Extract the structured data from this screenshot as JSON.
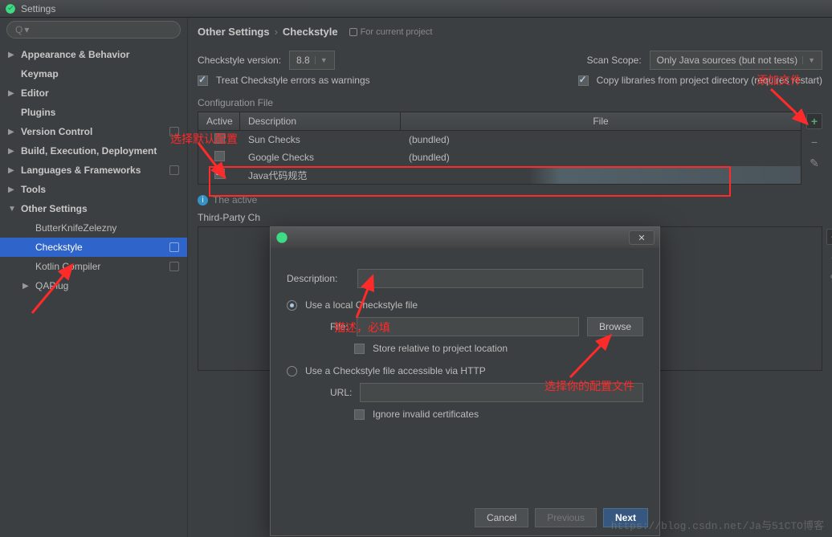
{
  "window": {
    "title": "Settings"
  },
  "search": {
    "placeholder": "Q"
  },
  "tree": {
    "appearance": "Appearance & Behavior",
    "keymap": "Keymap",
    "editor": "Editor",
    "plugins": "Plugins",
    "vcs": "Version Control",
    "build": "Build, Execution, Deployment",
    "lang": "Languages & Frameworks",
    "tools": "Tools",
    "other": "Other Settings",
    "butterknife": "ButterKnifeZelezny",
    "checkstyle": "Checkstyle",
    "kotlin": "Kotlin Compiler",
    "qaplug": "QAPlug"
  },
  "crumbs": {
    "other": "Other Settings",
    "checkstyle": "Checkstyle",
    "forproj": "For current project"
  },
  "opts": {
    "version_label": "Checkstyle version:",
    "version_value": "8.8",
    "scope_label": "Scan Scope:",
    "scope_value": "Only Java sources (but not tests)",
    "treat_warn": "Treat Checkstyle errors as warnings",
    "copy_libs": "Copy libraries from project directory (requires restart)"
  },
  "table": {
    "section": "Configuration File",
    "head_active": "Active",
    "head_desc": "Description",
    "head_file": "File",
    "rows": [
      {
        "desc": "Sun Checks",
        "file": "(bundled)",
        "checked": false
      },
      {
        "desc": "Google Checks",
        "file": "(bundled)",
        "checked": false
      },
      {
        "desc": "Java代码规范",
        "file": "",
        "checked": true
      }
    ]
  },
  "hint": "The active",
  "third_party": "Third-Party Ch",
  "dialog": {
    "desc_label": "Description:",
    "opt_local": "Use a local Checkstyle file",
    "file_label": "File:",
    "browse": "Browse",
    "store_relative": "Store relative to project location",
    "opt_http": "Use a Checkstyle file accessible via HTTP",
    "url_label": "URL:",
    "ignore_cert": "Ignore invalid certificates",
    "cancel": "Cancel",
    "previous": "Previous",
    "next": "Next"
  },
  "annot": {
    "select_default": "选择默认配置",
    "add_file": "添加文件",
    "desc_req": "描述，必填",
    "choose_cfg": "选择你的配置文件"
  },
  "watermark": "https://blog.csdn.net/Ja与51CTO博客"
}
